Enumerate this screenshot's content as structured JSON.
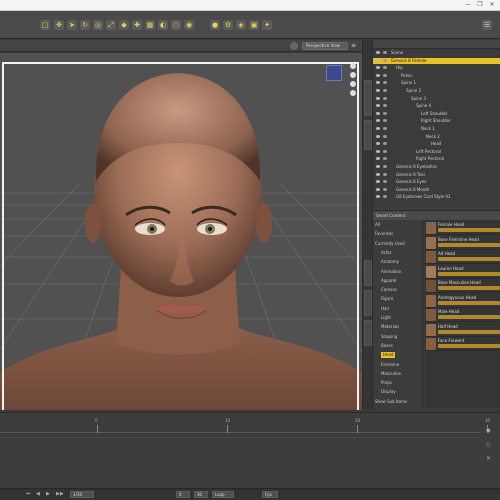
{
  "window": {
    "minimize": "—",
    "restore": "❐",
    "close": "✕"
  },
  "viewport": {
    "camera": "Perspective View"
  },
  "scene": {
    "items": [
      {
        "label": "Scene",
        "depth": 0
      },
      {
        "label": "Genesis 8 Female",
        "depth": 0,
        "selected": true
      },
      {
        "label": "Hip",
        "depth": 1
      },
      {
        "label": "Pelvis",
        "depth": 2
      },
      {
        "label": "Spine 1",
        "depth": 2
      },
      {
        "label": "Spine 2",
        "depth": 3
      },
      {
        "label": "Spine 3",
        "depth": 4
      },
      {
        "label": "Spine 4",
        "depth": 5
      },
      {
        "label": "Left Shoulder",
        "depth": 6
      },
      {
        "label": "Right Shoulder",
        "depth": 6
      },
      {
        "label": "Neck 1",
        "depth": 6
      },
      {
        "label": "Neck 2",
        "depth": 7
      },
      {
        "label": "Head",
        "depth": 8
      },
      {
        "label": "Left Pectoral",
        "depth": 5
      },
      {
        "label": "Right Pectoral",
        "depth": 5
      },
      {
        "label": "Genesis 8 Eyelashes",
        "depth": 1
      },
      {
        "label": "Genesis 8 Tear",
        "depth": 1
      },
      {
        "label": "Genesis 8 Eyes",
        "depth": 1
      },
      {
        "label": "Genesis 8 Mouth",
        "depth": 1
      },
      {
        "label": "G8 Eyebrows Card Style 01",
        "depth": 1
      }
    ]
  },
  "library": {
    "header": "Smart Content",
    "tree": [
      "All",
      "Favorites",
      "Currently Used",
      "Actor",
      "Anatomy",
      "Animation",
      "Apparel",
      "Camera",
      "Figure",
      "Hair",
      "Light",
      "Materials",
      "Shaping",
      "Bases",
      "Head",
      "Feminine",
      "Masculine",
      "Props",
      "Display",
      "Show Sub Items"
    ],
    "assets": [
      {
        "name": "Female Head",
        "thumb": "#8a6448"
      },
      {
        "name": "Base Feminine Head",
        "thumb": "#9a7050"
      },
      {
        "name": "Alt Head",
        "thumb": "#7b5a3f"
      },
      {
        "name": "Lauren Head",
        "thumb": "#a57a58"
      },
      {
        "name": "Base Masculine Head",
        "thumb": "#6f513a"
      },
      {
        "name": "Androgynous Head",
        "thumb": "#8c6647"
      },
      {
        "name": "Male Head",
        "thumb": "#7d5b40"
      },
      {
        "name": "Half Head",
        "thumb": "#936a4b"
      },
      {
        "name": "Face Forward",
        "thumb": "#85603f"
      }
    ]
  },
  "timeline": {
    "ticks": [
      "0",
      "10",
      "20",
      "30"
    ],
    "fields": [
      "1/30",
      "0",
      "30",
      "Loop",
      "Fps"
    ]
  },
  "colors": {
    "accent": "#e9c028",
    "panel": "#3b3b3b",
    "viewport": "#515151"
  }
}
